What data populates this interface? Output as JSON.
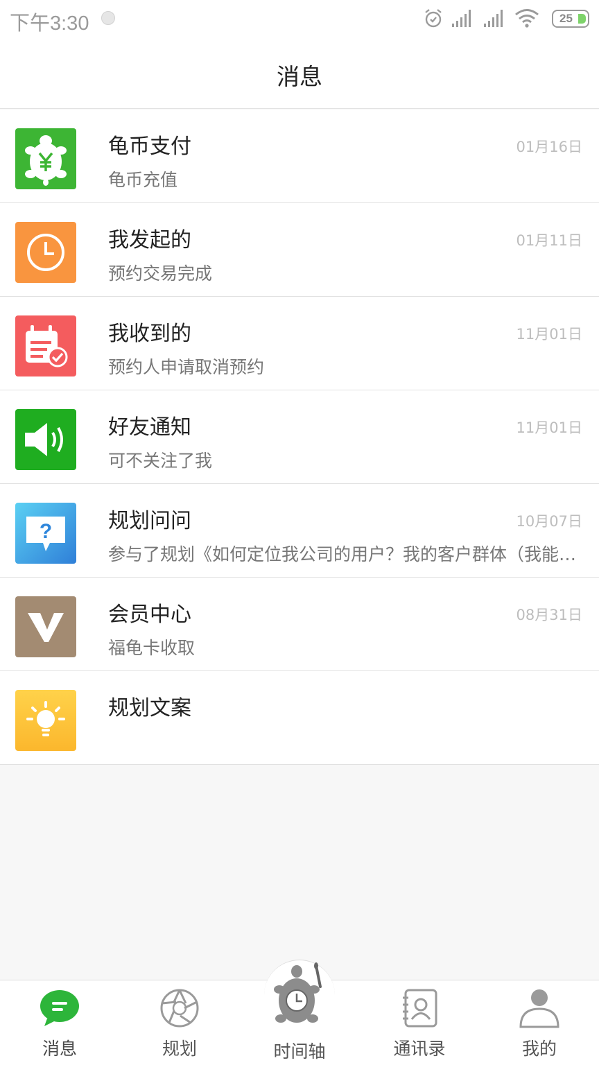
{
  "status_bar": {
    "time": "下午3:30",
    "battery": "25",
    "icons": [
      "notification-dot-icon",
      "alarm-icon",
      "signal-icon",
      "signal-icon",
      "wifi-icon",
      "battery-icon"
    ]
  },
  "header": {
    "title": "消息"
  },
  "messages": [
    {
      "name": "龟币支付",
      "preview": "龟币充值",
      "date": "01月16日",
      "icon": "turtle-yuan-icon",
      "color": "#3db534"
    },
    {
      "name": "我发起的",
      "preview": "预约交易完成",
      "date": "01月11日",
      "icon": "clock-icon",
      "color": "#f9953f"
    },
    {
      "name": "我收到的",
      "preview": "预约人申请取消预约",
      "date": "11月01日",
      "icon": "calendar-check-icon",
      "color": "#f45c5e"
    },
    {
      "name": "好友通知",
      "preview": "可不关注了我",
      "date": "11月01日",
      "icon": "speaker-icon",
      "color": "#1fad20"
    },
    {
      "name": "规划问问",
      "preview": "参与了规划《如何定位我公司的用户？我的客户群体（我能…",
      "date": "10月07日",
      "icon": "question-chat-icon",
      "color": "#43a3e8"
    },
    {
      "name": "会员中心",
      "preview": "福龟卡收取",
      "date": "08月31日",
      "icon": "vip-v-icon",
      "color": "#a38b72"
    },
    {
      "name": "规划文案",
      "preview": "",
      "date": "",
      "icon": "lightbulb-icon",
      "color": "#fcc43a"
    }
  ],
  "tabs": [
    {
      "label": "消息",
      "icon": "chat-bubble-icon",
      "active": true
    },
    {
      "label": "规划",
      "icon": "aperture-icon",
      "active": false
    },
    {
      "label": "时间轴",
      "icon": "turtle-clock-icon",
      "active": false
    },
    {
      "label": "通讯录",
      "icon": "contacts-book-icon",
      "active": false
    },
    {
      "label": "我的",
      "icon": "person-icon",
      "active": false
    }
  ],
  "colors": {
    "accent": "#2db53a",
    "text_primary": "#222222",
    "text_secondary": "#777777",
    "date": "#bdbdbd"
  }
}
